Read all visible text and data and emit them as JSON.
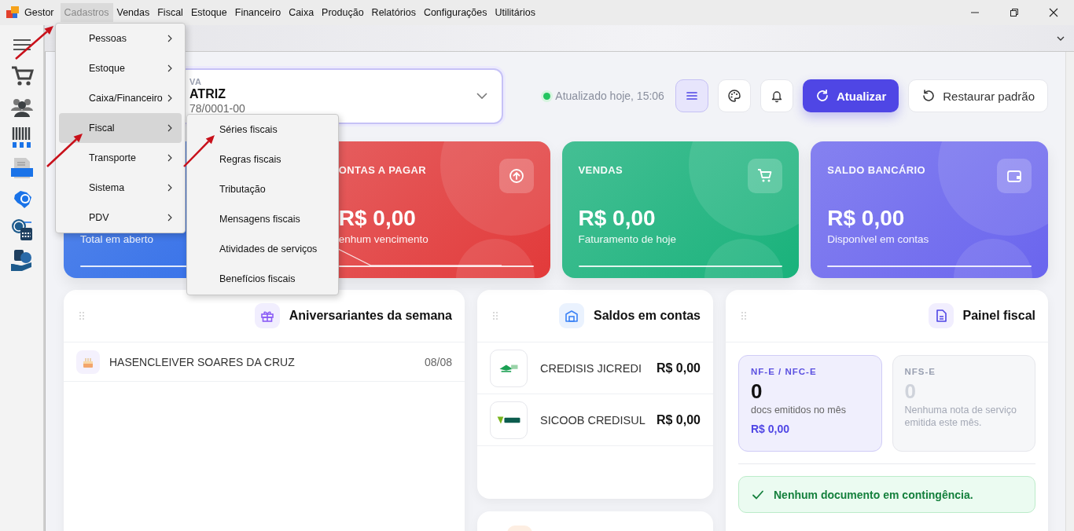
{
  "menubar": {
    "app_name": "Gestor",
    "items": [
      {
        "label": "Cadastros",
        "selected": true
      },
      {
        "label": "Vendas",
        "selected": false
      },
      {
        "label": "Fiscal",
        "selected": false
      },
      {
        "label": "Estoque",
        "selected": false
      },
      {
        "label": "Financeiro",
        "selected": false
      },
      {
        "label": "Caixa",
        "selected": false
      },
      {
        "label": "Produção",
        "selected": false
      },
      {
        "label": "Relatórios",
        "selected": false
      },
      {
        "label": "Configurações",
        "selected": false
      },
      {
        "label": "Utilitários",
        "selected": false
      }
    ]
  },
  "company_selector": {
    "label": "VA",
    "name": "ATRIZ",
    "document": "78/0001-00"
  },
  "status": {
    "text": "Atualizado hoje, 15:06",
    "online": true
  },
  "icon_buttons": [
    {
      "selected": true
    },
    {
      "selected": false
    },
    {
      "selected": false
    }
  ],
  "buttons": [
    {
      "label": "Atualizar",
      "kind": "primary"
    },
    {
      "label": "Restaurar padrão",
      "kind": "secondary"
    }
  ],
  "summary_cards": [
    {
      "subtitle": "Total em aberto",
      "color": "#2f6ce8",
      "trend_line": false
    },
    {
      "title": "ONTAS A PAGAR",
      "value": "R$ 0,00",
      "subtitle": "enhum vencimento",
      "color": "#e23a3a",
      "trend_line": true
    },
    {
      "title": "VENDAS",
      "value": "R$ 0,00",
      "subtitle": "Faturamento de hoje",
      "color": "#19b27b",
      "trend_line": false
    },
    {
      "title": "SALDO BANCÁRIO",
      "value": "R$ 0,00",
      "subtitle": "Disponível em contas",
      "color": "#6a65ee",
      "trend_line": false
    }
  ],
  "birthdays": {
    "title": "Aniversariantes da semana",
    "rows": [
      {
        "name": "HASENCLEIVER SOARES DA CRUZ",
        "date": "08/08"
      }
    ]
  },
  "balances": {
    "title": "Saldos em contas",
    "rows": [
      {
        "bank": "CREDISIS JICREDI",
        "amount": "R$ 0,00"
      },
      {
        "bank": "SICOOB CREDISUL",
        "amount": "R$ 0,00"
      }
    ]
  },
  "fiscal_panel": {
    "title": "Painel fiscal",
    "boxes": [
      {
        "label": "NF-E / NFC-E",
        "count": "0",
        "description": "docs emitidos no mês",
        "amount": "R$ 0,00",
        "active": true
      },
      {
        "label": "NFS-E",
        "count": "0",
        "description": "Nenhuma nota de serviço emitida este mês.",
        "active": false
      }
    ],
    "notice": "Nenhum documento em contingência."
  },
  "dropdown": {
    "items": [
      {
        "label": "Pessoas",
        "selected": false
      },
      {
        "label": "Estoque",
        "selected": false
      },
      {
        "label": "Caixa/Financeiro",
        "selected": false
      },
      {
        "label": "Fiscal",
        "selected": true
      },
      {
        "label": "Transporte",
        "selected": false
      },
      {
        "label": "Sistema",
        "selected": false
      },
      {
        "label": "PDV",
        "selected": false
      }
    ]
  },
  "submenu": {
    "items": [
      {
        "label": "Séries fiscais",
        "selected": false
      },
      {
        "label": "Regras fiscais",
        "selected": false
      },
      {
        "label": "Tributação",
        "selected": false
      },
      {
        "label": "Mensagens fiscais",
        "selected": false
      },
      {
        "label": "Atividades de serviços",
        "selected": false
      },
      {
        "label": "Benefícios fiscais",
        "selected": false
      }
    ]
  }
}
